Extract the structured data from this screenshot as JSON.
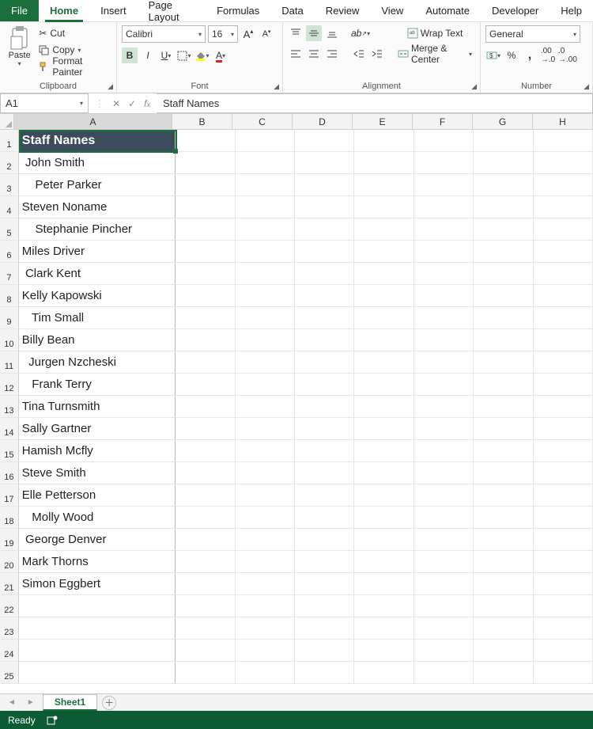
{
  "tabs": [
    "File",
    "Home",
    "Insert",
    "Page Layout",
    "Formulas",
    "Data",
    "Review",
    "View",
    "Automate",
    "Developer",
    "Help"
  ],
  "active_tab": "Home",
  "ribbon": {
    "clipboard": {
      "paste": "Paste",
      "cut": "Cut",
      "copy": "Copy",
      "format_painter": "Format Painter",
      "label": "Clipboard"
    },
    "font": {
      "name": "Calibri",
      "size": "16",
      "label": "Font"
    },
    "alignment": {
      "wrap": "Wrap Text",
      "merge": "Merge & Center",
      "label": "Alignment"
    },
    "number": {
      "format": "General",
      "label": "Number"
    }
  },
  "name_box": "A1",
  "formula_value": "Staff Names",
  "columns": [
    "A",
    "B",
    "C",
    "D",
    "E",
    "F",
    "G",
    "H"
  ],
  "rows_total": 25,
  "colA": [
    "Staff Names",
    " John Smith",
    "    Peter Parker",
    "Steven Noname",
    "    Stephanie Pincher",
    "Miles Driver",
    " Clark Kent",
    "Kelly Kapowski",
    "   Tim Small",
    "Billy Bean",
    "  Jurgen Nzcheski",
    "   Frank Terry",
    "Tina Turnsmith",
    "Sally Gartner",
    "Hamish Mcfly",
    "Steve Smith",
    "Elle Petterson",
    "   Molly Wood",
    " George Denver",
    "Mark Thorns",
    "Simon Eggbert",
    "",
    "",
    "",
    ""
  ],
  "sheet_tabs": [
    "Sheet1"
  ],
  "active_sheet": "Sheet1",
  "status": {
    "ready": "Ready"
  }
}
